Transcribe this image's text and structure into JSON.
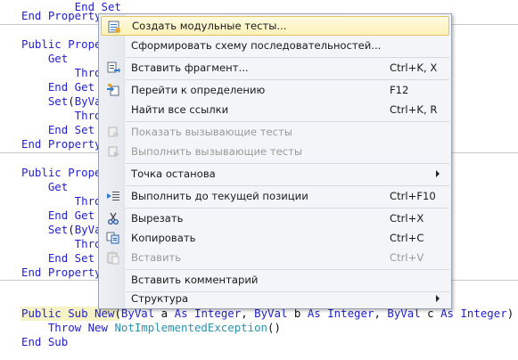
{
  "code": {
    "lines": [
      {
        "t": 0,
        "parts": [
          {
            "c": "kw",
            "v": "        End Set"
          }
        ]
      },
      {
        "t": 10,
        "parts": [
          {
            "c": "kw",
            "v": "End Property"
          }
        ]
      },
      {
        "t": 42,
        "parts": [
          {
            "c": "kw",
            "v": "Public Proper"
          }
        ]
      },
      {
        "t": 58,
        "parts": [
          {
            "c": "kw",
            "v": "    Get"
          }
        ]
      },
      {
        "t": 74,
        "parts": [
          {
            "c": "kw",
            "v": "        Throw"
          }
        ]
      },
      {
        "t": 90,
        "parts": [
          {
            "c": "kw",
            "v": "    End Get"
          }
        ]
      },
      {
        "t": 106,
        "parts": [
          {
            "c": "kw",
            "v": "    Set"
          },
          {
            "c": "tx",
            "v": "("
          },
          {
            "c": "kw",
            "v": "ByVal"
          }
        ]
      },
      {
        "t": 122,
        "parts": [
          {
            "c": "kw",
            "v": "        Throw"
          }
        ]
      },
      {
        "t": 138,
        "parts": [
          {
            "c": "kw",
            "v": "    End Set"
          }
        ]
      },
      {
        "t": 154,
        "parts": [
          {
            "c": "kw",
            "v": "End Property"
          }
        ]
      },
      {
        "t": 186,
        "parts": [
          {
            "c": "kw",
            "v": "Public Proper"
          }
        ]
      },
      {
        "t": 202,
        "parts": [
          {
            "c": "kw",
            "v": "    Get"
          }
        ]
      },
      {
        "t": 218,
        "parts": [
          {
            "c": "kw",
            "v": "        Throw"
          }
        ]
      },
      {
        "t": 234,
        "parts": [
          {
            "c": "kw",
            "v": "    End Get"
          }
        ]
      },
      {
        "t": 250,
        "parts": [
          {
            "c": "kw",
            "v": "    Set"
          },
          {
            "c": "tx",
            "v": "("
          },
          {
            "c": "kw",
            "v": "ByVal"
          }
        ]
      },
      {
        "t": 266,
        "parts": [
          {
            "c": "kw",
            "v": "        Throw"
          }
        ]
      },
      {
        "t": 282,
        "parts": [
          {
            "c": "kw",
            "v": "    End Set"
          }
        ]
      },
      {
        "t": 298,
        "parts": [
          {
            "c": "kw",
            "v": "End Property"
          }
        ]
      },
      {
        "t": 344,
        "parts": [
          {
            "c": "kw",
            "v": "Public Sub New"
          },
          {
            "c": "tx",
            "v": "("
          },
          {
            "c": "kw",
            "v": "ByVal"
          },
          {
            "c": "tx",
            "v": " a "
          },
          {
            "c": "kw",
            "v": "As Integer"
          },
          {
            "c": "tx",
            "v": ", "
          },
          {
            "c": "kw",
            "v": "ByVal"
          },
          {
            "c": "tx",
            "v": " b "
          },
          {
            "c": "kw",
            "v": "As Integer"
          },
          {
            "c": "tx",
            "v": ", "
          },
          {
            "c": "kw",
            "v": "ByVal"
          },
          {
            "c": "tx",
            "v": " c "
          },
          {
            "c": "kw",
            "v": "As Integer"
          },
          {
            "c": "tx",
            "v": ")"
          }
        ]
      },
      {
        "t": 360,
        "parts": [
          {
            "c": "kw",
            "v": "    Throw New "
          },
          {
            "c": "ty",
            "v": "NotImplementedException"
          },
          {
            "c": "tx",
            "v": "()"
          }
        ]
      },
      {
        "t": 376,
        "parts": [
          {
            "c": "kw",
            "v": "End Sub"
          }
        ]
      }
    ]
  },
  "menu": {
    "items": [
      {
        "label": "Создать модульные тесты...",
        "shortcut": "",
        "icon": "create-unit-tests-icon",
        "selected": true
      },
      {
        "label": "Сформировать схему последовательностей...",
        "shortcut": ""
      },
      {
        "label": "Вставить фрагмент...",
        "shortcut": "Ctrl+K, X",
        "icon": "insert-snippet-icon"
      },
      {
        "label": "Перейти к определению",
        "shortcut": "F12",
        "icon": "go-to-definition-icon"
      },
      {
        "label": "Найти все ссылки",
        "shortcut": "Ctrl+K, R"
      },
      {
        "label": "Показать вызывающие тесты",
        "shortcut": "",
        "icon": "show-calling-tests-icon",
        "disabled": true
      },
      {
        "label": "Выполнить вызывающие тесты",
        "shortcut": "",
        "icon": "run-calling-tests-icon",
        "disabled": true
      },
      {
        "label": "Точка останова",
        "shortcut": "",
        "submenu": true
      },
      {
        "label": "Выполнить до текущей позиции",
        "shortcut": "Ctrl+F10",
        "icon": "run-to-cursor-icon"
      },
      {
        "label": "Вырезать",
        "shortcut": "Ctrl+X",
        "icon": "cut-icon"
      },
      {
        "label": "Копировать",
        "shortcut": "Ctrl+C",
        "icon": "copy-icon"
      },
      {
        "label": "Вставить",
        "shortcut": "Ctrl+V",
        "icon": "paste-icon",
        "disabled": true
      },
      {
        "label": "Вставить комментарий",
        "shortcut": ""
      },
      {
        "label": "Структура",
        "shortcut": "",
        "submenu": true
      }
    ]
  }
}
